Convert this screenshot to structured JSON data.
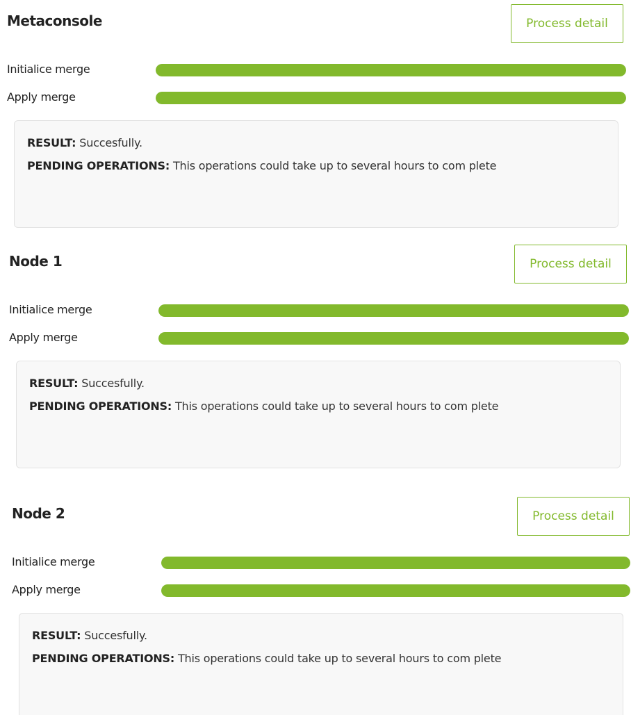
{
  "colors": {
    "accent": "#82b92c",
    "box_background": "#f8f8f8",
    "box_border": "#e2e2e2"
  },
  "sections": [
    {
      "title": "Metaconsole",
      "button_label": "Process detail",
      "steps": [
        {
          "label": "Initialice merge",
          "progress_percent": 100
        },
        {
          "label": "Apply merge",
          "progress_percent": 100
        }
      ],
      "result_key": "RESULT:",
      "result_value": " Succesfully.",
      "pending_key": "PENDING OPERATIONS:",
      "pending_value": " This operations could take up to several hours to com plete"
    },
    {
      "title": "Node 1",
      "button_label": "Process detail",
      "steps": [
        {
          "label": "Initialice merge",
          "progress_percent": 100
        },
        {
          "label": "Apply merge",
          "progress_percent": 100
        }
      ],
      "result_key": "RESULT:",
      "result_value": " Succesfully.",
      "pending_key": "PENDING OPERATIONS:",
      "pending_value": " This operations could take up to several hours to com plete"
    },
    {
      "title": "Node 2",
      "button_label": "Process detail",
      "steps": [
        {
          "label": "Initialice merge",
          "progress_percent": 100
        },
        {
          "label": "Apply merge",
          "progress_percent": 100
        }
      ],
      "result_key": "RESULT:",
      "result_value": " Succesfully.",
      "pending_key": "PENDING OPERATIONS:",
      "pending_value": " This operations could take up to several hours to com plete"
    }
  ]
}
